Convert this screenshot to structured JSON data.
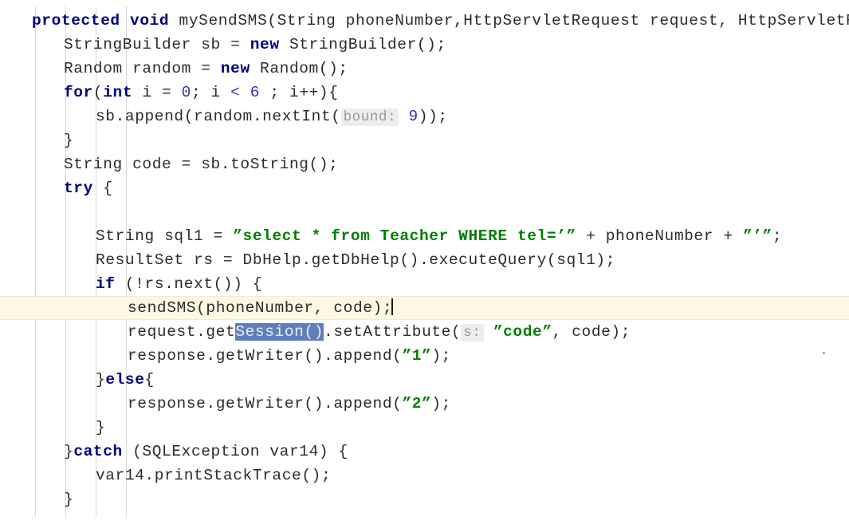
{
  "editor": {
    "language": "java",
    "theme": "light",
    "colors": {
      "background": "#ffffff",
      "foreground": "#2b2b2b",
      "keyword": "#00007f",
      "string": "#008000",
      "number": "#3333bb",
      "parameter_hint_text": "#9a9a9a",
      "parameter_hint_background": "#ededed",
      "selection_background": "#5f7fb8",
      "selection_foreground": "#e8eef8",
      "caret_line_background": "#fdf8e3",
      "indent_guide": "#d8d8d8",
      "caret": "#1c1c1c"
    },
    "caret": {
      "line": 10,
      "column_after": "sendSMS(phoneNumber, code);"
    },
    "selection": {
      "line": 11,
      "text": "Session()"
    },
    "indent_guide_x": [
      44,
      82,
      120,
      158
    ],
    "lines": [
      {
        "n": 1,
        "indent": 0,
        "tokens": [
          {
            "t": "protected",
            "k": "kw"
          },
          {
            "t": " ",
            "k": "plain"
          },
          {
            "t": "void",
            "k": "kw"
          },
          {
            "t": " mySendSMS(String phoneNumber,HttpServletRequest request, HttpServletResponse response)",
            "k": "plain"
          }
        ]
      },
      {
        "n": 2,
        "indent": 1,
        "tokens": [
          {
            "t": "StringBuilder sb = ",
            "k": "plain"
          },
          {
            "t": "new",
            "k": "kw"
          },
          {
            "t": " StringBuilder();",
            "k": "plain"
          }
        ]
      },
      {
        "n": 3,
        "indent": 1,
        "tokens": [
          {
            "t": "Random random = ",
            "k": "plain"
          },
          {
            "t": "new",
            "k": "kw"
          },
          {
            "t": " Random();",
            "k": "plain"
          }
        ]
      },
      {
        "n": 4,
        "indent": 1,
        "tokens": [
          {
            "t": "for",
            "k": "kw"
          },
          {
            "t": "(",
            "k": "plain"
          },
          {
            "t": "int",
            "k": "kw"
          },
          {
            "t": " i = ",
            "k": "plain"
          },
          {
            "t": "0",
            "k": "num"
          },
          {
            "t": "; i ",
            "k": "plain"
          },
          {
            "t": "<",
            "k": "num"
          },
          {
            "t": " ",
            "k": "plain"
          },
          {
            "t": "6",
            "k": "num"
          },
          {
            "t": " ; i++){",
            "k": "plain"
          }
        ]
      },
      {
        "n": 5,
        "indent": 2,
        "tokens": [
          {
            "t": "sb.append(random.nextInt(",
            "k": "plain"
          },
          {
            "t": "bound:",
            "k": "hint"
          },
          {
            "t": " ",
            "k": "plain"
          },
          {
            "t": "9",
            "k": "num"
          },
          {
            "t": "));",
            "k": "plain"
          }
        ]
      },
      {
        "n": 6,
        "indent": 1,
        "tokens": [
          {
            "t": "}",
            "k": "plain"
          }
        ]
      },
      {
        "n": 7,
        "indent": 1,
        "tokens": [
          {
            "t": "String code = sb.toString();",
            "k": "plain"
          }
        ]
      },
      {
        "n": 8,
        "indent": 1,
        "tokens": [
          {
            "t": "try",
            "k": "kw"
          },
          {
            "t": " {",
            "k": "plain"
          }
        ]
      },
      {
        "n": 9,
        "indent": 0,
        "tokens": [
          {
            "t": "",
            "k": "plain"
          }
        ]
      },
      {
        "n": 10,
        "indent": 2,
        "tokens": [
          {
            "t": "String sql1 = ",
            "k": "plain"
          },
          {
            "t": "”select * from Teacher WHERE tel=’”",
            "k": "str"
          },
          {
            "t": " + phoneNumber + ",
            "k": "plain"
          },
          {
            "t": "”’”",
            "k": "str"
          },
          {
            "t": ";",
            "k": "plain"
          }
        ]
      },
      {
        "n": 11,
        "indent": 2,
        "tokens": [
          {
            "t": "ResultSet rs = DbHelp.getDbHelp().executeQuery(sql1);",
            "k": "plain"
          }
        ]
      },
      {
        "n": 12,
        "indent": 2,
        "tokens": [
          {
            "t": "if",
            "k": "kw"
          },
          {
            "t": " (!rs.next()) {",
            "k": "plain"
          }
        ]
      },
      {
        "n": 13,
        "indent": 3,
        "caret_line": true,
        "tokens": [
          {
            "t": "sendSMS(phoneNumber, code);",
            "k": "plain"
          },
          {
            "t": "",
            "k": "caret"
          }
        ]
      },
      {
        "n": 14,
        "indent": 3,
        "tokens": [
          {
            "t": "request.get",
            "k": "plain"
          },
          {
            "t": "Session()",
            "k": "sel"
          },
          {
            "t": ".setAttribute(",
            "k": "plain"
          },
          {
            "t": "s:",
            "k": "hint"
          },
          {
            "t": " ",
            "k": "plain"
          },
          {
            "t": "”code”",
            "k": "str"
          },
          {
            "t": ", code);",
            "k": "plain"
          }
        ]
      },
      {
        "n": 15,
        "indent": 3,
        "tokens": [
          {
            "t": "response.getWriter().append(",
            "k": "plain"
          },
          {
            "t": "”1”",
            "k": "str"
          },
          {
            "t": ");",
            "k": "plain"
          }
        ]
      },
      {
        "n": 16,
        "indent": 2,
        "tokens": [
          {
            "t": "}",
            "k": "plain"
          },
          {
            "t": "else",
            "k": "kw"
          },
          {
            "t": "{",
            "k": "plain"
          }
        ]
      },
      {
        "n": 17,
        "indent": 3,
        "tokens": [
          {
            "t": "response.getWriter().append(",
            "k": "plain"
          },
          {
            "t": "”2”",
            "k": "str"
          },
          {
            "t": ");",
            "k": "plain"
          }
        ]
      },
      {
        "n": 18,
        "indent": 2,
        "tokens": [
          {
            "t": "}",
            "k": "plain"
          }
        ]
      },
      {
        "n": 19,
        "indent": 1,
        "tokens": [
          {
            "t": "}",
            "k": "plain"
          },
          {
            "t": "catch",
            "k": "kw"
          },
          {
            "t": " (SQLException var14) {",
            "k": "plain"
          }
        ]
      },
      {
        "n": 20,
        "indent": 2,
        "tokens": [
          {
            "t": "var14.printStackTrace();",
            "k": "plain"
          }
        ]
      },
      {
        "n": 21,
        "indent": 1,
        "tokens": [
          {
            "t": "}",
            "k": "plain"
          }
        ]
      }
    ]
  }
}
